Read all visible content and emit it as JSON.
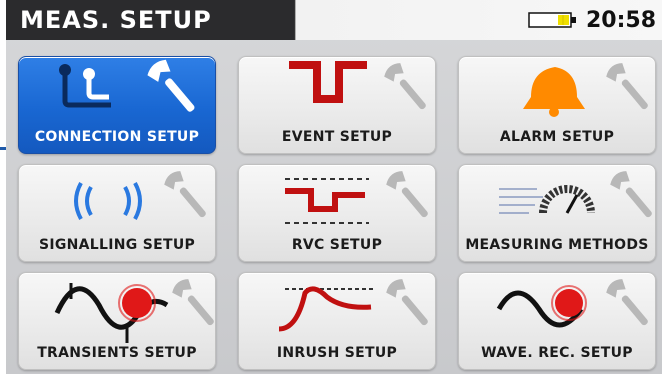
{
  "header": {
    "title": "MEAS. SETUP",
    "time": "20:58"
  },
  "icons": {
    "battery": "battery-icon",
    "wrench": "wrench-icon"
  },
  "tiles": [
    {
      "label": "CONNECTION SETUP",
      "icon": "connection-icon",
      "selected": true
    },
    {
      "label": "EVENT SETUP",
      "icon": "event-dip-icon",
      "selected": false
    },
    {
      "label": "ALARM SETUP",
      "icon": "alarm-bell-icon",
      "selected": false
    },
    {
      "label": "SIGNALLING SETUP",
      "icon": "signal-waves-icon",
      "selected": false
    },
    {
      "label": "RVC SETUP",
      "icon": "rvc-icon",
      "selected": false
    },
    {
      "label": "MEASURING METHODS",
      "icon": "measuring-gauge-icon",
      "selected": false
    },
    {
      "label": "TRANSIENTS SETUP",
      "icon": "transients-wave-icon",
      "selected": false
    },
    {
      "label": "INRUSH SETUP",
      "icon": "inrush-curve-icon",
      "selected": false
    },
    {
      "label": "WAVE. REC. SETUP",
      "icon": "sine-record-icon",
      "selected": false
    }
  ],
  "colors": {
    "active_tile": "#1967d2",
    "accent_red": "#d11414",
    "header_bg": "#2b2b2d",
    "battery_fill": "#f0e000"
  }
}
